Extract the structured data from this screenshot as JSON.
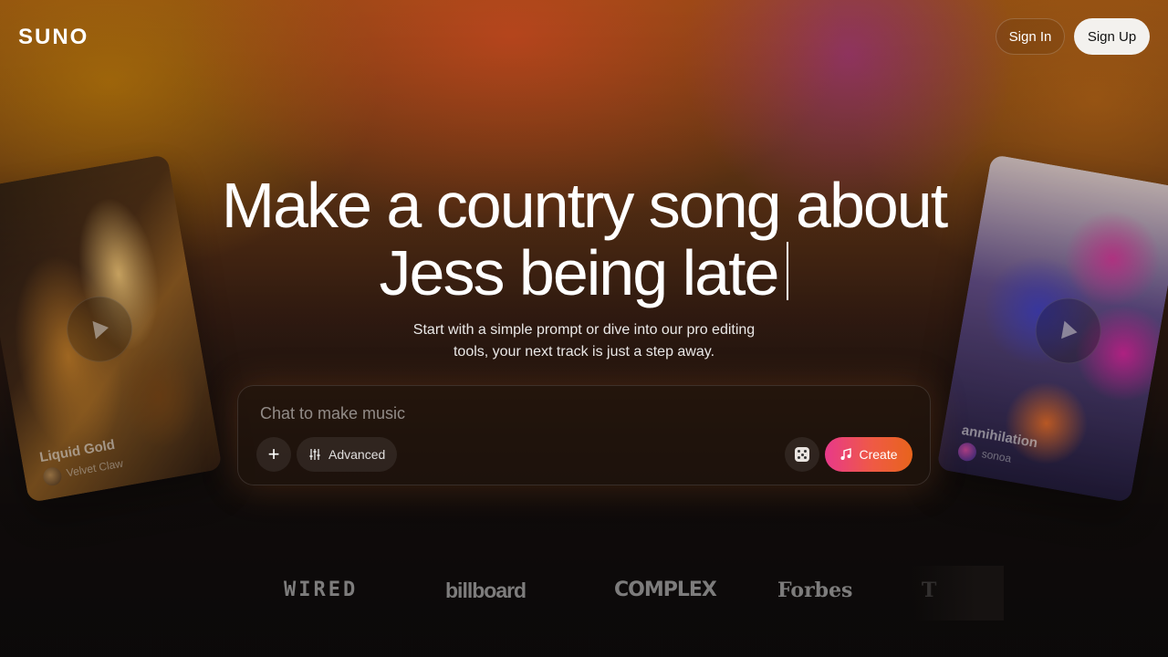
{
  "header": {
    "logo": "SUNO",
    "sign_in": "Sign In",
    "sign_up": "Sign Up"
  },
  "hero": {
    "headline_line1": "Make a country song about",
    "headline_line2": "Jess being late",
    "subtitle_line1": "Start with a simple prompt or dive into our pro editing",
    "subtitle_line2": "tools, your next track is just a step away."
  },
  "composer": {
    "placeholder": "Chat to make music",
    "plus_label": "+",
    "advanced_label": "Advanced",
    "create_label": "Create"
  },
  "cards": [
    {
      "title": "Liquid Gold",
      "artist": "Velvet Claw"
    },
    {
      "title": "annihilation",
      "artist": "sonoa"
    }
  ],
  "press": {
    "wired": "WIRED",
    "billboard": "billboard",
    "complex": "COMPLEX",
    "forbes": "Forbes",
    "partial": "T"
  },
  "colors": {
    "create_gradient_start": "#e8398a",
    "create_gradient_end": "#e8641c",
    "sign_up_bg": "#f3f1ee"
  }
}
